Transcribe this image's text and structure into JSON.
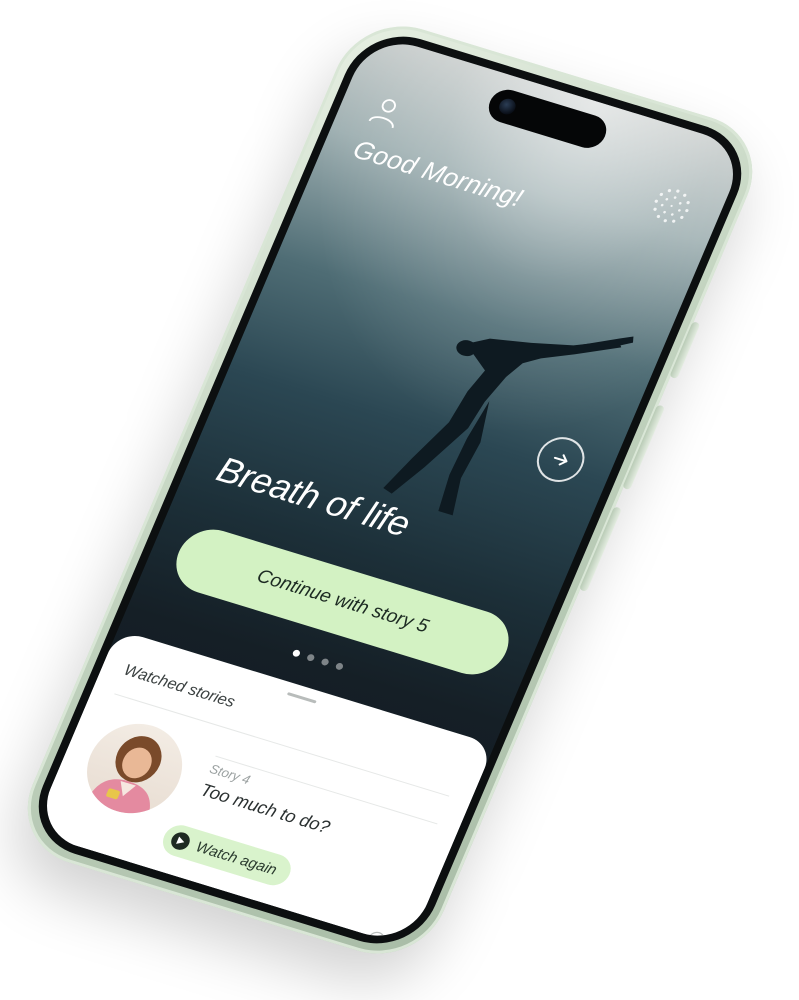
{
  "header": {
    "greeting": "Good Morning!"
  },
  "hero": {
    "title": "Breath of life",
    "cta_label": "Continue with story 5",
    "pager": {
      "total": 4,
      "active": 1
    }
  },
  "watched": {
    "title": "Watched stories",
    "items": [
      {
        "number_label": "Story 4",
        "title": "Too much to do?",
        "action_label": "Watch again"
      }
    ]
  },
  "colors": {
    "cta_background": "#d3f2c3",
    "watch_again_background": "#d9f3cc",
    "phone_frame": "#c3d4c0",
    "screen_top": "#c8cdcc",
    "screen_bottom": "#111820"
  },
  "icons": {
    "profile": "person-outline-icon",
    "logo": "dotted-sunburst-icon",
    "next": "arrow-right-icon",
    "play": "play-icon",
    "emoji": "smile-icon"
  }
}
